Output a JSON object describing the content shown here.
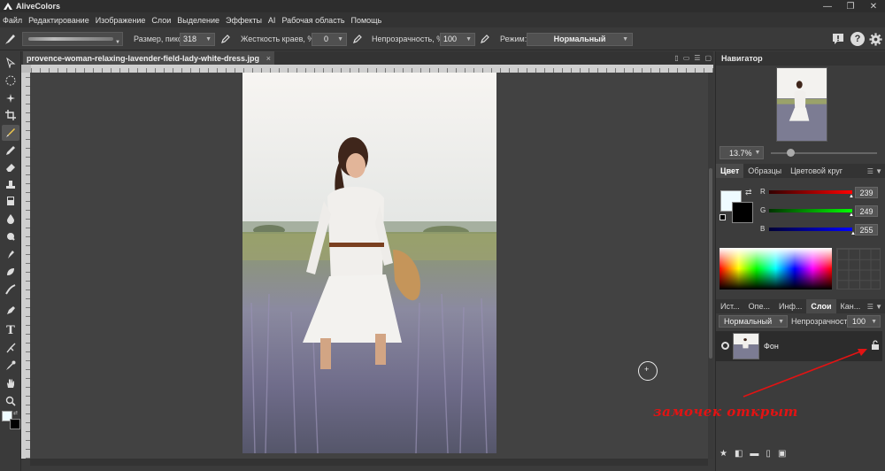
{
  "titlebar": {
    "app_name": "AliveColors",
    "controls": [
      "—",
      "❐",
      "✕"
    ]
  },
  "menu": [
    "Файл",
    "Редактирование",
    "Изображение",
    "Слои",
    "Выделение",
    "Эффекты",
    "AI",
    "Рабочая область",
    "Помощь"
  ],
  "options": {
    "size_label": "Размер, пикс",
    "size_value": "318",
    "hardness_label": "Жесткость краев, %",
    "hardness_value": "0",
    "opacity_label": "Непрозрачность, %",
    "opacity_value": "100",
    "mode_label": "Режим:",
    "mode_value": "Нормальный",
    "right_icons": [
      "alert-icon",
      "help-icon",
      "settings-icon"
    ]
  },
  "document": {
    "tab_title": "provence-woman-relaxing-lavender-field-lady-white-dress.jpg",
    "tab_close": "×"
  },
  "navigator": {
    "title": "Навигатор",
    "zoom": "13.7%"
  },
  "color_panel": {
    "tabs": [
      "Цвет",
      "Образцы",
      "Цветовой круг"
    ],
    "active_tab": "Цвет",
    "channels": [
      {
        "letter": "R",
        "value": "239",
        "color": "#e02020"
      },
      {
        "letter": "G",
        "value": "249",
        "color": "#1fbf1f"
      },
      {
        "letter": "B",
        "value": "255",
        "color": "#2030e0"
      }
    ],
    "fg_color": "#effbff",
    "bg_color": "#000000"
  },
  "layers_panel": {
    "tabs": [
      "Ист...",
      "Опе...",
      "Инф...",
      "Слои",
      "Кан..."
    ],
    "active_tab": "Слои",
    "blend_mode": "Нормальный",
    "opacity_label": "Непрозрачность",
    "opacity_value": "100",
    "layer_name": "Фон"
  },
  "annotation": {
    "text": "замочек открыт",
    "color": "#e21313"
  }
}
